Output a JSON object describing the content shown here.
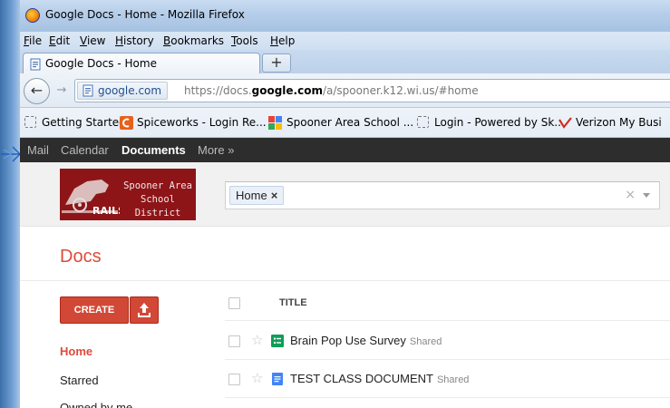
{
  "window": {
    "title": "Google Docs - Home - Mozilla Firefox"
  },
  "menu": {
    "items": [
      "File",
      "Edit",
      "View",
      "History",
      "Bookmarks",
      "Tools",
      "Help"
    ]
  },
  "tabs": {
    "active_label": "Google Docs - Home",
    "new_tab_label": "+"
  },
  "navbar": {
    "back_label": "←",
    "forward_label": "→",
    "site_identity": "google.com",
    "url_prefix": "https://docs.",
    "url_domain": "google.com",
    "url_suffix": "/a/spooner.k12.wi.us/#home"
  },
  "bookmarks": {
    "items": [
      "Getting Started",
      "Spiceworks - Login Re...",
      "Spooner Area School ...",
      "Login - Powered by Sk...",
      "Verizon My Busi"
    ]
  },
  "gbar": {
    "items": [
      "Mail",
      "Calendar",
      "Documents",
      "More »"
    ]
  },
  "header": {
    "logo_line1": "Spooner Area",
    "logo_line2": "School District",
    "search_chip": "Home",
    "search_chip_remove": "×",
    "search_clear": "×"
  },
  "docs": {
    "title": "Docs",
    "create_label": "CREATE",
    "nav": [
      "Home",
      "Starred",
      "Owned by me"
    ],
    "column_title": "TITLE",
    "files": [
      {
        "name": "Brain Pop Use Survey",
        "badge": "Shared",
        "type": "form"
      },
      {
        "name": "TEST CLASS DOCUMENT",
        "badge": "Shared",
        "type": "document"
      }
    ]
  },
  "colors": {
    "accent_red": "#dd4b39",
    "create_button": "#d14836",
    "gbar_background": "#2d2d2d",
    "logo_background": "#8d1518",
    "form_icon": "#0f9d58",
    "doc_icon": "#4285f4"
  }
}
